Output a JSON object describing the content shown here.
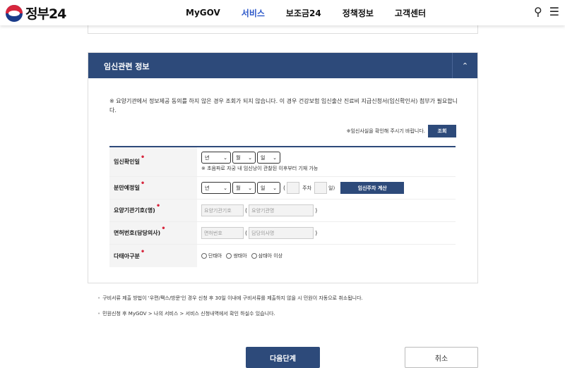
{
  "header": {
    "logo_text": "정부24",
    "nav": [
      "MyGOV",
      "서비스",
      "보조금24",
      "정책정보",
      "고객센터"
    ],
    "active_nav": "서비스",
    "search_icon": "⚲",
    "menu_icon": "☰"
  },
  "section": {
    "title": "임신관련 정보",
    "toggle_icon": "⌃",
    "notice": "※ 요양기관에서 정보제공 동의를 하지 않은 경우 조회가 되지 않습니다. 이 경우 건강보험 임신출산 진료비 지급신청서(임신확인서) 첨부가 필요합니다.",
    "confirm_text": "※임신사실을 확인해 주시기 바랍니다.",
    "confirm_button": "조회"
  },
  "form": {
    "pregnancy_date": {
      "label": "임신확인일",
      "year": "년",
      "month": "월",
      "day": "일",
      "hint": "※ 초음파로 자궁 내 임신낭이 관찰된 이후부터 기재 가능"
    },
    "due_date": {
      "label": "분만예정일",
      "year": "년",
      "month": "월",
      "day": "일",
      "week_label": "주차",
      "day_label": "일)",
      "open_paren": "(",
      "calc_button": "임신주차 계산"
    },
    "institution": {
      "label": "요양기관기호(명)",
      "code_placeholder": "요양기관기호",
      "name_placeholder": "요양기관명",
      "open_paren": "(",
      "close_paren": ")"
    },
    "license": {
      "label": "면허번호(담당의사)",
      "number_placeholder": "면허번호",
      "doctor_placeholder": "담당의사명",
      "open_paren": "(",
      "close_paren": ")"
    },
    "fetus": {
      "label": "다태아구분",
      "options": [
        "단태아",
        "쌍태아",
        "삼태아 이상"
      ]
    }
  },
  "notes": [
    "구비서류 제출 방법이 '우편/팩스/방문'인 경우 신청 후 30일 이내에 구비서류를 제출하지 않을 시 민원이 자동으로 취소됩니다.",
    "민원신청 후 MyGOV > 나의 서비스 > 서비스 신청내역에서 확인 하실수 있습니다."
  ],
  "buttons": {
    "next": "다음단계",
    "cancel": "취소"
  },
  "colors": {
    "primary": "#2d4a7a",
    "active_nav": "#2b57c9",
    "required": "#d7263d"
  }
}
